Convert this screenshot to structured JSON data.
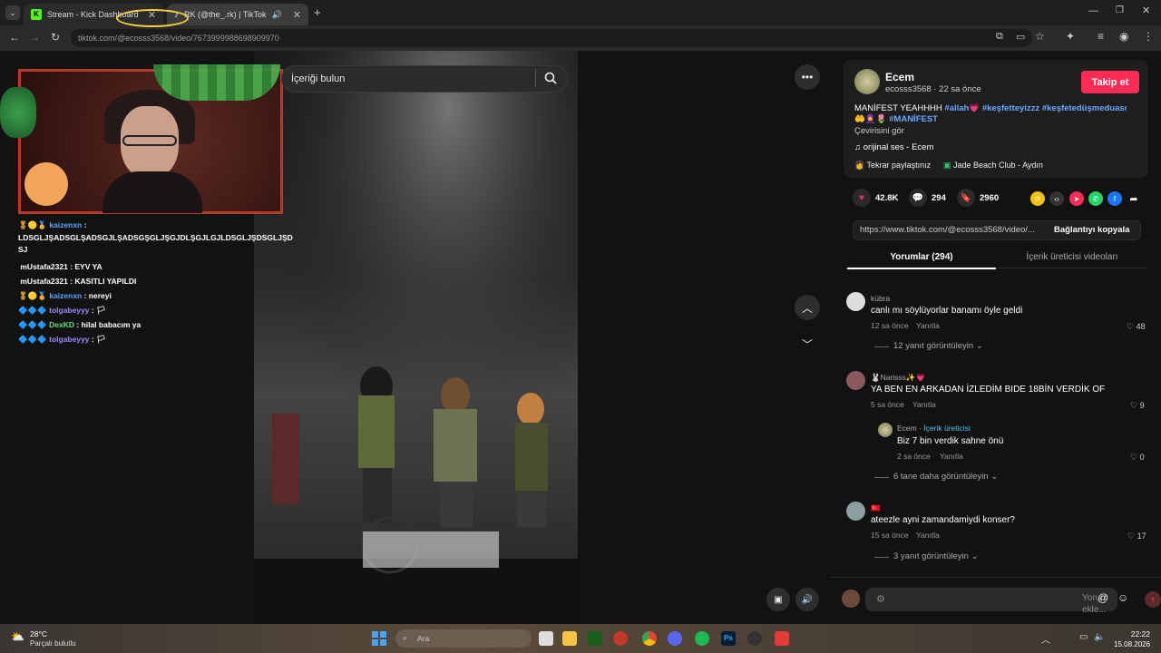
{
  "browser": {
    "tabs": [
      {
        "label": "Stream - Kick Dashboard"
      },
      {
        "label": "RK (@the_.rk) | TikTok"
      }
    ],
    "url": "ecosss3568/video/7673999988698909970",
    "url_prefix": "tiktok.com/@"
  },
  "stream_chat": [
    {
      "user": "kaizenxn",
      "text": "LDSGLJŞADSGLŞADSGJLŞADSGŞGLJŞGJDLŞGJLGJLDSGLJŞDSGLJŞD SJ"
    },
    {
      "user": "mUstafa2321",
      "text": "EYV YA"
    },
    {
      "user": "mUstafa2321",
      "text": "KASITLI YAPILDI"
    },
    {
      "user": "kaizenxn",
      "text": "nereyi"
    },
    {
      "user": "tolgabeyyy",
      "text": "🏳"
    },
    {
      "user": "DexKD",
      "text": "hilal babacım ya"
    },
    {
      "user": "tolgabeyyy",
      "text": "🏳"
    }
  ],
  "video": {
    "search_placeholder": "İçeriği bulun"
  },
  "post": {
    "author_name": "Ecem",
    "author_handle": "ecosss3568",
    "posted_ago": "22 sa önce",
    "follow_label": "Takip et",
    "description_text": "MANİFEST YEAHHHH",
    "hashtags": [
      "#allah💗",
      "#keşfetteyizzz",
      "#keşfetedüşmeduası🤲🧕🌷",
      "#MANİFEST"
    ],
    "translate_label": "Çevirisini gör",
    "music": "orijinal ses - Ecem",
    "repost_label": "Tekrar paylaştınız",
    "location": "Jade Beach Club - Aydın",
    "likes": "42.8K",
    "comments": "294",
    "saves": "2960",
    "link": "https://www.tiktok.com/@ecosss3568/video/...",
    "copy_link_label": "Bağlantıyı kopyala",
    "tab_comments": "Yorumlar (294)",
    "tab_videos": "İçerik üreticisi videoları"
  },
  "comments": [
    {
      "user": "kübra",
      "text": "canlı mı söylüyorlar banamı öyle geldi",
      "time": "12 sa önce",
      "reply_label": "Yanıtla",
      "likes": "48",
      "view_replies": "12 yanıt görüntüleyin"
    },
    {
      "user": "🐰Narisss✨💗",
      "text": "YA BEN EN ARKADAN İZLEDİM BIDE 18BİN VERDİK OF",
      "time": "5 sa önce",
      "reply_label": "Yanıtla",
      "likes": "9",
      "reply": {
        "user": "Ecem",
        "creator_tag": "İçerik üreticisi",
        "text": "Biz 7 bin verdik sahne önü",
        "time": "2 sa önce",
        "reply_label": "Yanıtla",
        "likes": "0"
      },
      "view_replies": "6 tane daha görüntüleyin"
    },
    {
      "user": "🇹🇷",
      "text": "ateezle ayni zamandamiydi konser?",
      "time": "15 sa önce",
      "reply_label": "Yanıtla",
      "likes": "17",
      "view_replies": "3 yanıt görüntüleyin"
    }
  ],
  "comment_input": {
    "placeholder": "Yorum ekle..."
  },
  "taskbar": {
    "temp": "28°C",
    "weather": "Parçalı bulutlu",
    "search": "Ara",
    "time": "22:22",
    "date": "15.08.2026"
  },
  "colors": {
    "accent": "#fe2c55",
    "hashtag": "#6aa9ff",
    "creator": "#4cc5f0"
  }
}
